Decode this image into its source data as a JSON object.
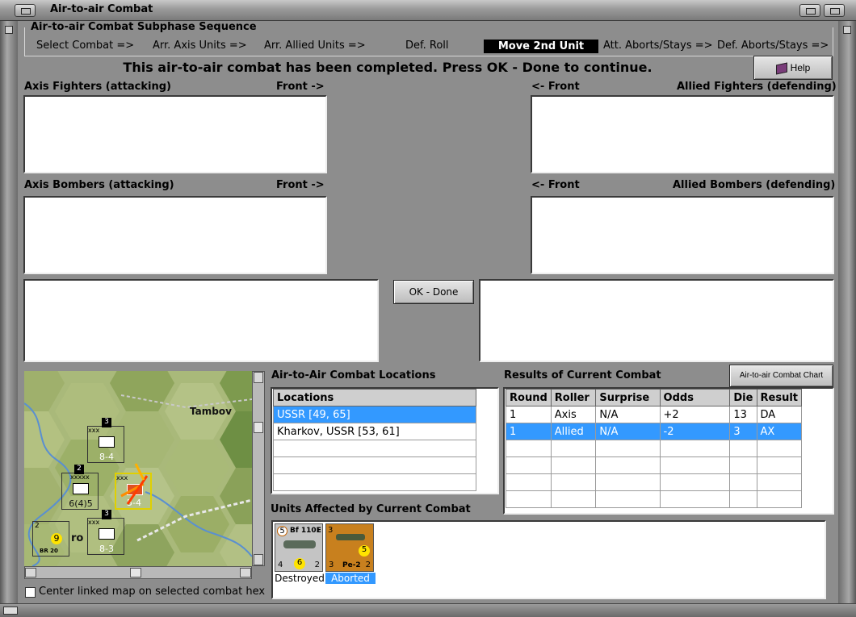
{
  "window": {
    "title": "Air-to-air Combat"
  },
  "sequence": {
    "title": "Air-to-air Combat Subphase Sequence",
    "steps": [
      "Select Combat =>",
      "Arr. Axis Units =>",
      "Arr. Allied Units =>",
      "Def. Roll",
      "Move 2nd Unit",
      "Att. Aborts/Stays =>",
      "Def. Aborts/Stays =>"
    ],
    "active_index": 4
  },
  "status_message": "This air-to-air combat has been completed.  Press OK - Done to continue.",
  "help_button": "Help",
  "axis_fighters": {
    "label": "Axis Fighters (attacking)",
    "front": "Front ->"
  },
  "allied_fighters": {
    "label": "Allied Fighters (defending)",
    "front": "<- Front"
  },
  "axis_bombers": {
    "label": "Axis Bombers (attacking)",
    "front": "Front ->"
  },
  "allied_bombers": {
    "label": "Allied Bombers (defending)",
    "front": "<- Front"
  },
  "ok_button": "OK - Done",
  "map": {
    "city_label": "Tambov",
    "partial_label": "ro",
    "counters": [
      {
        "top": "xxx",
        "value": "8-4",
        "stack": "3",
        "color": "#bdbdbd"
      },
      {
        "top": "xxxxx",
        "value": "6(4)5",
        "stack": "2",
        "color": "#bdbdbd"
      },
      {
        "top": "xxx",
        "value": "5-4",
        "stack": "",
        "color": "#c87a1e"
      },
      {
        "top": "xxx",
        "value": "8-3",
        "stack": "3",
        "color": "#bdbdbd"
      },
      {
        "top": "BR 20",
        "value": "9",
        "stack": "2",
        "color": "#d8d66a"
      }
    ]
  },
  "center_map_checkbox": "Center linked map on selected combat hex",
  "locations": {
    "title": "Air-to-Air Combat Locations",
    "header": "Locations",
    "rows": [
      "USSR [49, 65]",
      "Kharkov, USSR [53, 61]",
      "",
      "",
      "",
      ""
    ],
    "selected_index": 0
  },
  "results": {
    "title": "Results of Current Combat",
    "chart_button": "Air-to-air Combat Chart",
    "columns": [
      "Round",
      "Roller",
      "Surprise",
      "Odds",
      "Die",
      "Result"
    ],
    "rows": [
      [
        "1",
        "Axis",
        "N/A",
        "+2",
        "13",
        "DA"
      ],
      [
        "1",
        "Allied",
        "N/A",
        "-2",
        "3",
        "AX"
      ],
      [
        "",
        "",
        "",
        "",
        "",
        ""
      ],
      [
        "",
        "",
        "",
        "",
        "",
        ""
      ],
      [
        "",
        "",
        "",
        "",
        "",
        ""
      ],
      [
        "",
        "",
        "",
        "",
        "",
        ""
      ]
    ],
    "selected_index": 1
  },
  "affected": {
    "title": "Units Affected by Current Combat",
    "units": [
      {
        "name": "Bf 110E",
        "top_left": "5",
        "top_right": "1",
        "bottom_left": "4",
        "bottom_mid": "6",
        "bottom_right": "2",
        "status": "Destroyed",
        "color": "#c4c4c4"
      },
      {
        "name": "Pe-2",
        "top_left": "3",
        "top_right": "",
        "bottom_left": "3",
        "bottom_mid": "5",
        "bottom_right": "2",
        "status": "Aborted",
        "color": "#c8801e"
      }
    ]
  }
}
